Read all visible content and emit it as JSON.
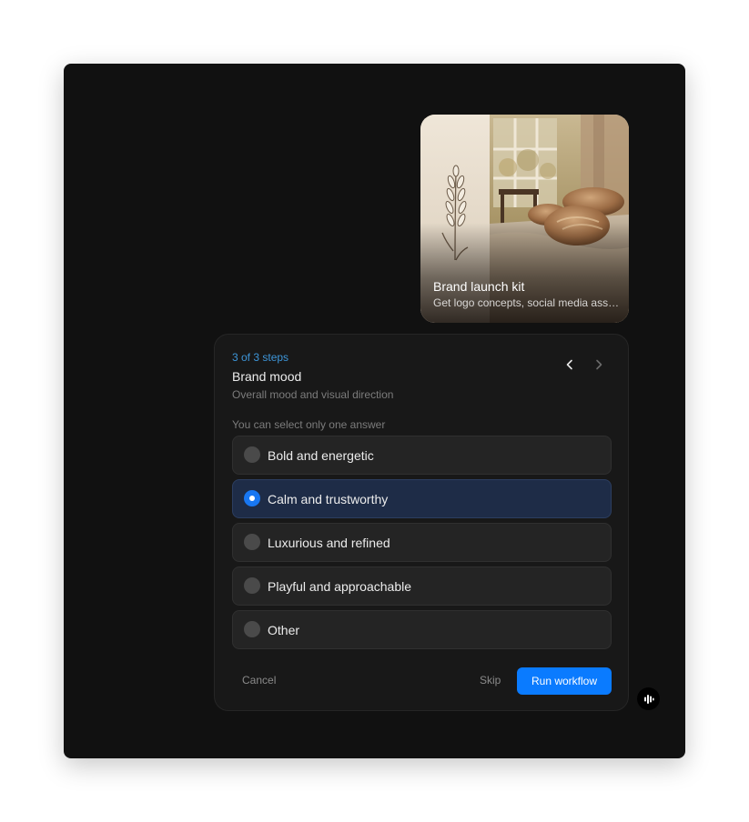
{
  "promo": {
    "title": "Brand launch kit",
    "subtitle": "Get logo concepts, social media assets and more",
    "image": "wheat-and-bread-photo"
  },
  "question": {
    "step_label": "3 of 3 steps",
    "title": "Brand mood",
    "description": "Overall mood and visual direction",
    "hint": "You can select only one answer",
    "options": [
      {
        "label": "Bold and energetic",
        "selected": false
      },
      {
        "label": "Calm and trustworthy",
        "selected": true
      },
      {
        "label": "Luxurious and refined",
        "selected": false
      },
      {
        "label": "Playful and approachable",
        "selected": false
      },
      {
        "label": "Other",
        "selected": false
      }
    ]
  },
  "nav": {
    "prev_icon": "chevron-left-icon",
    "next_icon": "chevron-right-icon"
  },
  "actions": {
    "cancel_label": "Cancel",
    "skip_label": "Skip",
    "run_label": "Run workflow"
  },
  "fab": {
    "icon": "audio-bars-icon"
  },
  "colors": {
    "window_bg": "#111111",
    "panel_bg": "#181818",
    "accent": "#0a7bff",
    "step_accent": "#3d95d8",
    "selected_option_bg": "#1e2c47"
  }
}
